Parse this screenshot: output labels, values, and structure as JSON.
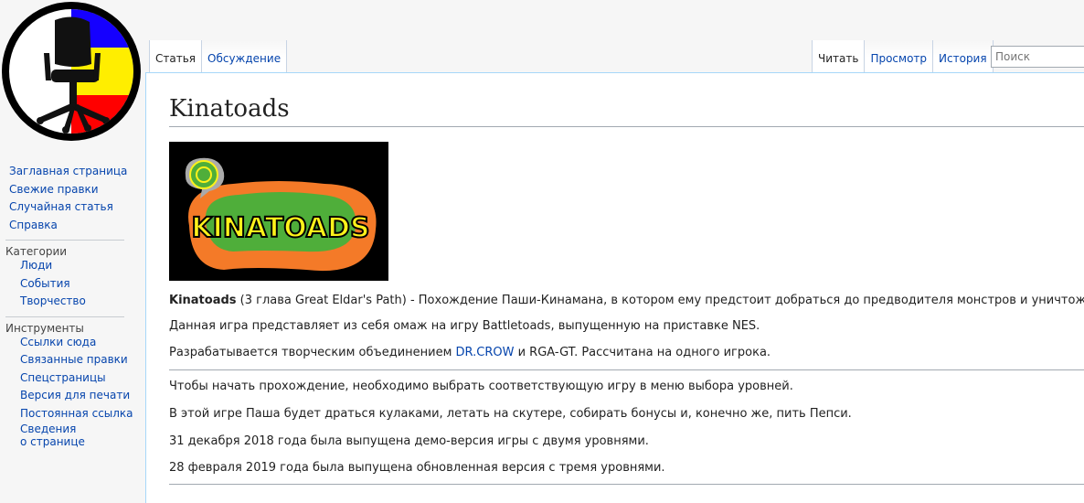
{
  "tabs": {
    "article": "Статья",
    "discussion": "Обсуждение",
    "read": "Читать",
    "view": "Просмотр",
    "history": "История"
  },
  "search": {
    "placeholder": "Поиск"
  },
  "sidebar": {
    "nav": [
      "Заглавная страница",
      "Свежие правки",
      "Случайная статья",
      "Справка"
    ],
    "categories": {
      "title": "Категории",
      "items": [
        "Люди",
        "События",
        "Творчество"
      ]
    },
    "tools": {
      "title": "Инструменты",
      "items": [
        "Ссылки сюда",
        "Связанные правки",
        "Спецстраницы",
        "Версия для печати",
        "Постоянная ссылка"
      ],
      "info_line1": "Сведения",
      "info_line2": "о странице"
    }
  },
  "article": {
    "title": "Kinatoads",
    "logo_text": "KINATOADS",
    "p1": {
      "bold": "Kinatoads",
      "rest": " (3 глава Great Eldar's Path) - Похождение Паши-Кинамана, в котором ему предстоит добраться до предводителя монстров и уничтожить их."
    },
    "p2": "Данная игра представляет из себя омаж на игру Battletoads, выпущенную на приставке NES.",
    "p3": {
      "before": "Разрабатывается творческим объединением ",
      "link": "DR.CROW",
      "after": " и RGA-GT. Рассчитана на одного игрока."
    },
    "p4": "Чтобы начать прохождение, необходимо выбрать соответствующую игру в меню выбора уровней.",
    "p5": "В этой игре Паша будет драться кулаками, летать на скутере, собирать бонусы и, конечно же, пить Пепси.",
    "p6": "31 декабря 2018 года была выпущена демо-версия игры с двумя уровнями.",
    "p7": "28 февраля 2019 года была выпущена обновленная версия с тремя уровнями."
  },
  "colors": {
    "link": "#0645ad",
    "flag_blue": "#1500ff",
    "flag_yellow": "#ffee00",
    "flag_red": "#ff0000",
    "logo_green": "#4fae3a",
    "logo_orange": "#f47a28",
    "logo_yellow": "#fff21a"
  }
}
